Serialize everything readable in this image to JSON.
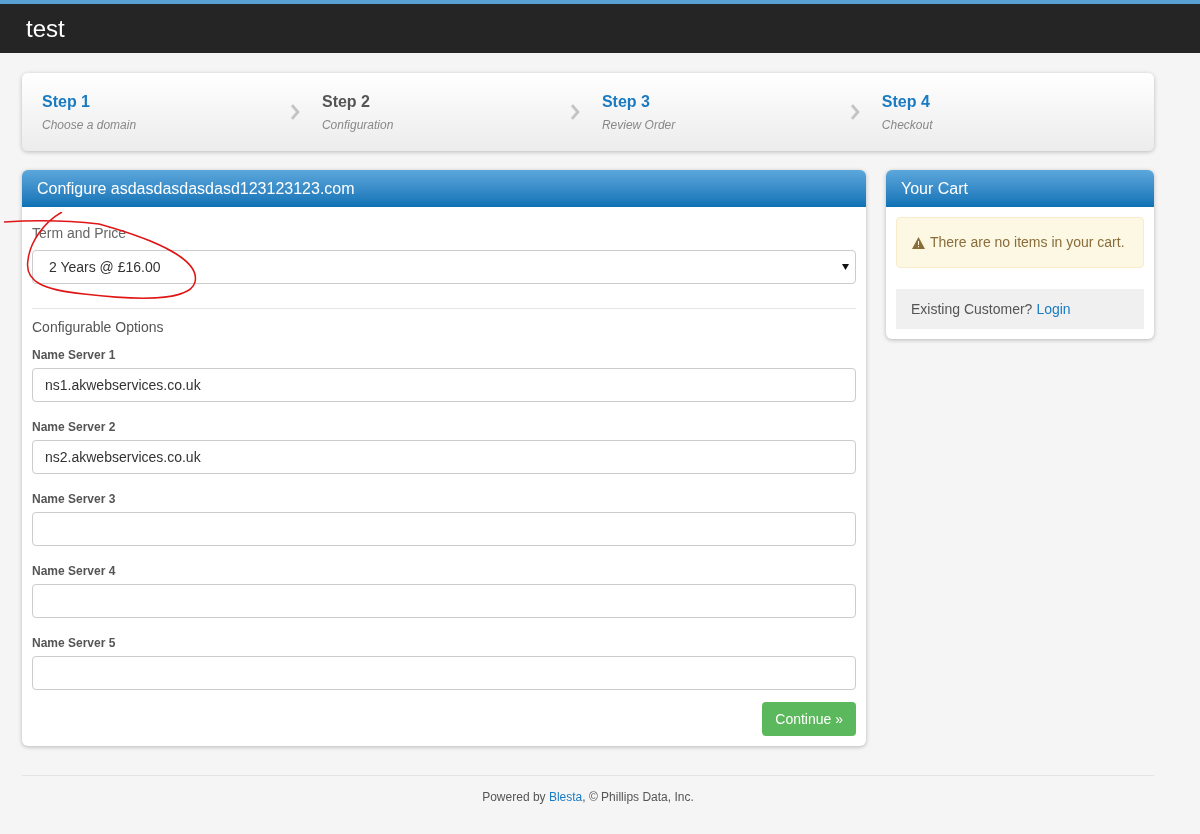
{
  "brand": "test",
  "steps": [
    {
      "title": "Step 1",
      "subtitle": "Choose a domain",
      "selected": false
    },
    {
      "title": "Step 2",
      "subtitle": "Configuration",
      "selected": true
    },
    {
      "title": "Step 3",
      "subtitle": "Review Order",
      "selected": false
    },
    {
      "title": "Step 4",
      "subtitle": "Checkout",
      "selected": false
    }
  ],
  "configure": {
    "title": "Configure asdasdasdasdasd123123123.com",
    "term_label": "Term and Price",
    "term_value": "2 Years @ £16.00",
    "options_heading": "Configurable Options",
    "fields": [
      {
        "label": "Name Server 1",
        "value": "ns1.akwebservices.co.uk"
      },
      {
        "label": "Name Server 2",
        "value": "ns2.akwebservices.co.uk"
      },
      {
        "label": "Name Server 3"
      },
      {
        "label": "Name Server 4"
      },
      {
        "label": "Name Server 5"
      }
    ],
    "button": "Continue »"
  },
  "cart": {
    "title": "Your Cart",
    "alert": "There are no items in your cart.",
    "customer_text": "Existing Customer?",
    "login": "Login"
  },
  "footer": {
    "before": "Powered by",
    "link": "Blesta",
    "after": ", © Phillips Data, Inc."
  }
}
